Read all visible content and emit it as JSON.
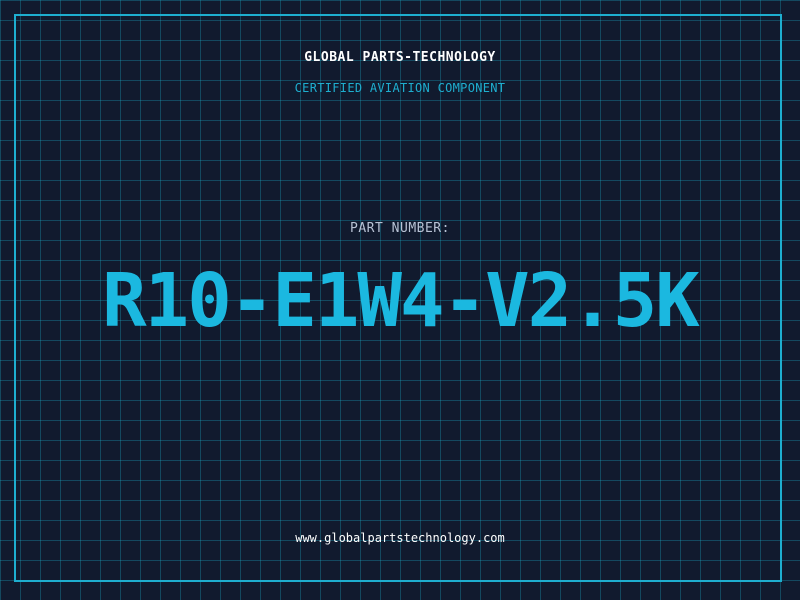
{
  "header": {
    "company": "GLOBAL PARTS-TECHNOLOGY",
    "subtitle": "CERTIFIED AVIATION COMPONENT"
  },
  "part": {
    "label": "PART NUMBER:",
    "number": "R10-E1W4-V2.5K"
  },
  "footer": {
    "url": "www.globalpartstechnology.com"
  },
  "colors": {
    "background": "#111a2e",
    "grid": "#1aaac8",
    "accent": "#1bb8e0",
    "text": "#ffffff",
    "label": "#b8c2d4"
  }
}
